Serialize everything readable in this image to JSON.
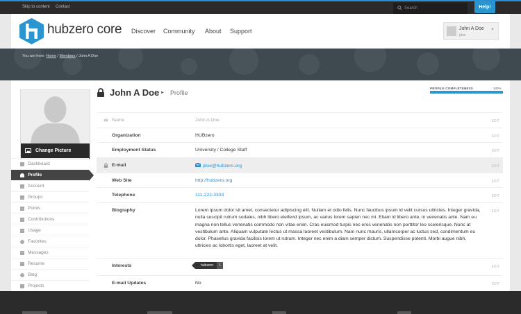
{
  "topbar": {
    "skip_label": "Skip to content",
    "contact_label": "Contact",
    "search_placeholder": "Search",
    "help_label": "Help!"
  },
  "header": {
    "brand": "hubzero core",
    "nav": [
      "Discover",
      "Community",
      "About",
      "Support"
    ],
    "user_name": "John A Doe",
    "user_handle": "jdoe"
  },
  "breadcrumb": {
    "prefix": "You are here:",
    "home": "Home",
    "sep": "/",
    "members": "Members",
    "current": "John A Doe"
  },
  "profile": {
    "change_picture": "Change Picture",
    "name": "John A Doe",
    "section": "Profile",
    "section_arrow": "►",
    "completeness_label": "PROFILE COMPLETENESS",
    "completeness_pct": "100%",
    "completeness_value": 1.0
  },
  "sidebar": {
    "items": [
      {
        "label": "Dashboard",
        "icon": "dashboard-icon"
      },
      {
        "label": "Profile",
        "icon": "user-icon",
        "active": true
      },
      {
        "label": "Account",
        "icon": "account-icon"
      },
      {
        "label": "Groups",
        "icon": "groups-icon"
      },
      {
        "label": "Points",
        "icon": "points-icon"
      },
      {
        "label": "Contributions",
        "icon": "contributions-icon"
      },
      {
        "label": "Usage",
        "icon": "usage-icon"
      },
      {
        "label": "Favorites",
        "icon": "heart-icon"
      },
      {
        "label": "Messages",
        "icon": "messages-icon"
      },
      {
        "label": "Resume",
        "icon": "resume-icon"
      },
      {
        "label": "Blog",
        "icon": "blog-icon"
      },
      {
        "label": "Projects",
        "icon": "projects-icon"
      }
    ]
  },
  "fields": {
    "edit_label": "EDIT",
    "name": {
      "label": "Name",
      "value": "John A Doe"
    },
    "organization": {
      "label": "Organization",
      "value": "HUBzero"
    },
    "employment": {
      "label": "Employment Status",
      "value": "University / College Staff"
    },
    "email": {
      "label": "E-mail",
      "value": "jdoe@hubzero.org"
    },
    "website": {
      "label": "Web Site",
      "value": "http://hubzero.org"
    },
    "telephone": {
      "label": "Telephone",
      "value": "111-222-3333"
    },
    "biography": {
      "label": "Biography",
      "value": "Lorem ipsum dolor sit amet, consectetur adipiscing elit. Nullam et odio felis. Nunc faucibus ipsum id velit cursus ultricies. Integer gravida, nulla suscipit rutrum sodales, nibh libero eleifend ipsum, ac varius lorem sapien nec mi. Etiam id libero ante, in venenatis ante. Nam eu magna non tellus venenatis commodo non vitae enim. Cras euismod turpis nec eros venenatis non porttitor leo scelerisque. Nunc at vestibulum ante. Aliquam vulputate lectus ut massa laoreet vestibulum. Nam nunc mauris, ullamcorper ac luctus sed, condimentum eu dolor. Phasellus gravida facilisis lorem ut rutrum. Integer nec enim a diam semper dictum. Suspendisse potenti. Morbi augue nibh, ultricies ac lobortis eget, laoreet at velit."
    },
    "interests": {
      "label": "Interests",
      "tag": "hubzero",
      "count": "1"
    },
    "email_updates": {
      "label": "E-mail Updates",
      "value": "No"
    }
  },
  "colors": {
    "accent": "#2b95d0",
    "dark": "#2b2b2b",
    "band": "#3e4a50"
  }
}
